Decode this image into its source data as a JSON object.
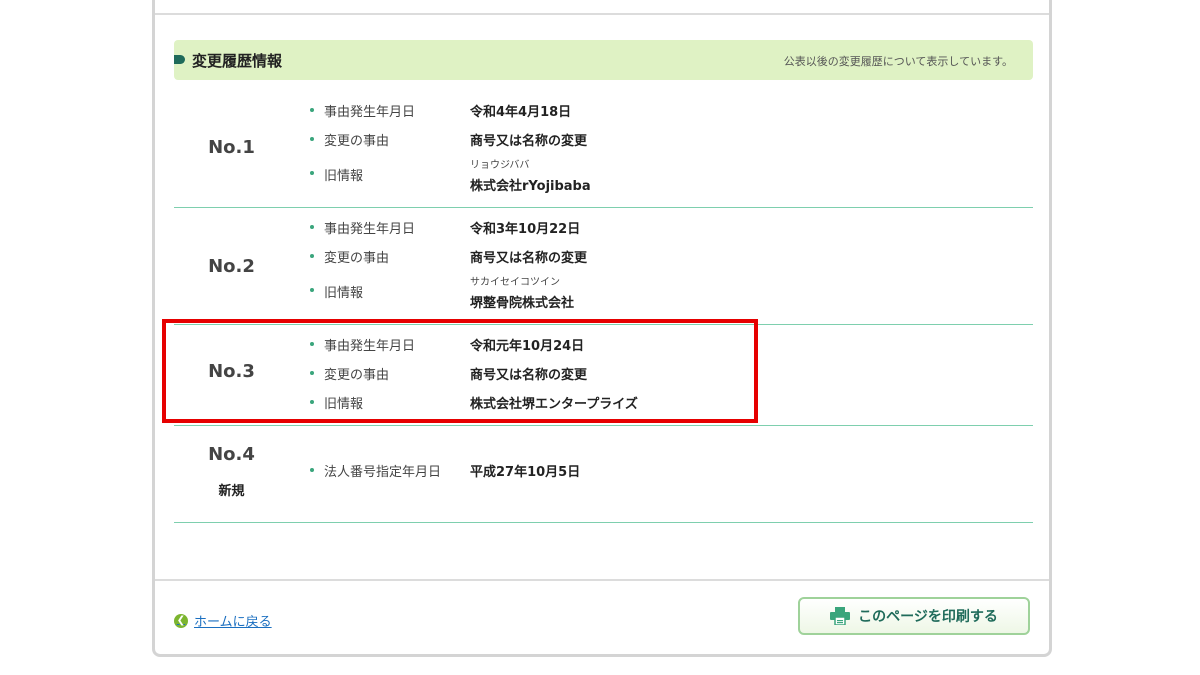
{
  "section": {
    "title": "変更履歴情報",
    "note": "公表以後の変更履歴について表示しています。"
  },
  "entries": [
    {
      "no": "No.1",
      "rows": [
        {
          "label": "事由発生年月日",
          "value": "令和4年4月18日"
        },
        {
          "label": "変更の事由",
          "value": "商号又は名称の変更"
        },
        {
          "label": "旧情報",
          "ruby": "リョウジババ",
          "value": "株式会社rYojibaba"
        }
      ]
    },
    {
      "no": "No.2",
      "rows": [
        {
          "label": "事由発生年月日",
          "value": "令和3年10月22日"
        },
        {
          "label": "変更の事由",
          "value": "商号又は名称の変更"
        },
        {
          "label": "旧情報",
          "ruby": "サカイセイコツイン",
          "value": "堺整骨院株式会社"
        }
      ]
    },
    {
      "no": "No.3",
      "rows": [
        {
          "label": "事由発生年月日",
          "value": "令和元年10月24日"
        },
        {
          "label": "変更の事由",
          "value": "商号又は名称の変更"
        },
        {
          "label": "旧情報",
          "value": "株式会社堺エンタープライズ"
        }
      ]
    },
    {
      "no": "No.4",
      "sub": "新規",
      "rows": [
        {
          "label": "法人番号指定年月日",
          "value": "平成27年10月5日"
        }
      ]
    }
  ],
  "footer": {
    "home_link": "ホームに戻る",
    "print_button": "このページを印刷する",
    "home_icon": "chevron-left-circle-icon",
    "print_icon": "printer-icon"
  },
  "colors": {
    "header_bg": "#dff2c4",
    "accent_green": "#1f6b5a",
    "separator": "#7ecfae",
    "highlight": "#e60000",
    "link": "#1b6fc0"
  }
}
